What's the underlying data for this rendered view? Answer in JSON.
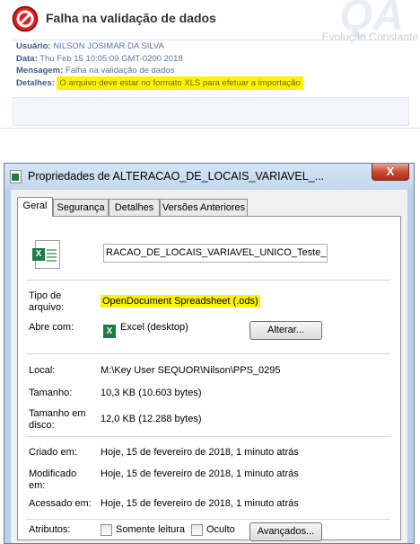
{
  "error_panel": {
    "title": "Falha na validação de dados",
    "watermark_main": "QA",
    "watermark_sub": "Evolução Constante",
    "rows": [
      {
        "key": "Usuário:",
        "value": "NILSON JOSIMAR DA SILVA"
      },
      {
        "key": "Data:",
        "value": "Thu Feb 15 10:05:09 GMT-0200 2018"
      },
      {
        "key": "Mensagem:",
        "value": "Falha na validação de dados"
      },
      {
        "key": "Detalhes:",
        "value": "O arquivo deve estar no formato XLS para efetuar a importação"
      }
    ],
    "highlight_color": "#fff200"
  },
  "dialog": {
    "title": "Propriedades de ALTERACAO_DE_LOCAIS_VARIAVEL_...",
    "close_label": "X",
    "tabs": [
      "Geral",
      "Segurança",
      "Detalhes",
      "Versões Anteriores"
    ],
    "active_tab": "Geral",
    "file_name": "RACAO_DE_LOCAIS_VARIAVEL_UNICO_Teste_",
    "file_type_label": "Tipo de arquivo:",
    "file_type_value": "OpenDocument Spreadsheet (.ods)",
    "open_with_label": "Abre com:",
    "open_with_value": "Excel (desktop)",
    "change_button": "Alterar...",
    "location_label": "Local:",
    "location_value": "M:\\Key User SEQUOR\\Nilson\\PPS_0295",
    "size_label": "Tamanho:",
    "size_value": "10,3 KB (10.603 bytes)",
    "size_on_disk_label": "Tamanho em disco:",
    "size_on_disk_value": "12,0 KB (12.288 bytes)",
    "created_label": "Criado em:",
    "created_value": "Hoje, 15 de fevereiro de 2018, 1 minuto atrás",
    "modified_label": "Modificado em:",
    "modified_value": "Hoje, 15 de fevereiro de 2018, 1 minuto atrás",
    "accessed_label": "Acessado em:",
    "accessed_value": "Hoje, 15 de fevereiro de 2018, 1 minuto atrás",
    "attributes_label": "Atributos:",
    "readonly_label": "Somente leitura",
    "hidden_label": "Oculto",
    "advanced_button": "Avançados...",
    "excel_icon_letter": "X"
  }
}
